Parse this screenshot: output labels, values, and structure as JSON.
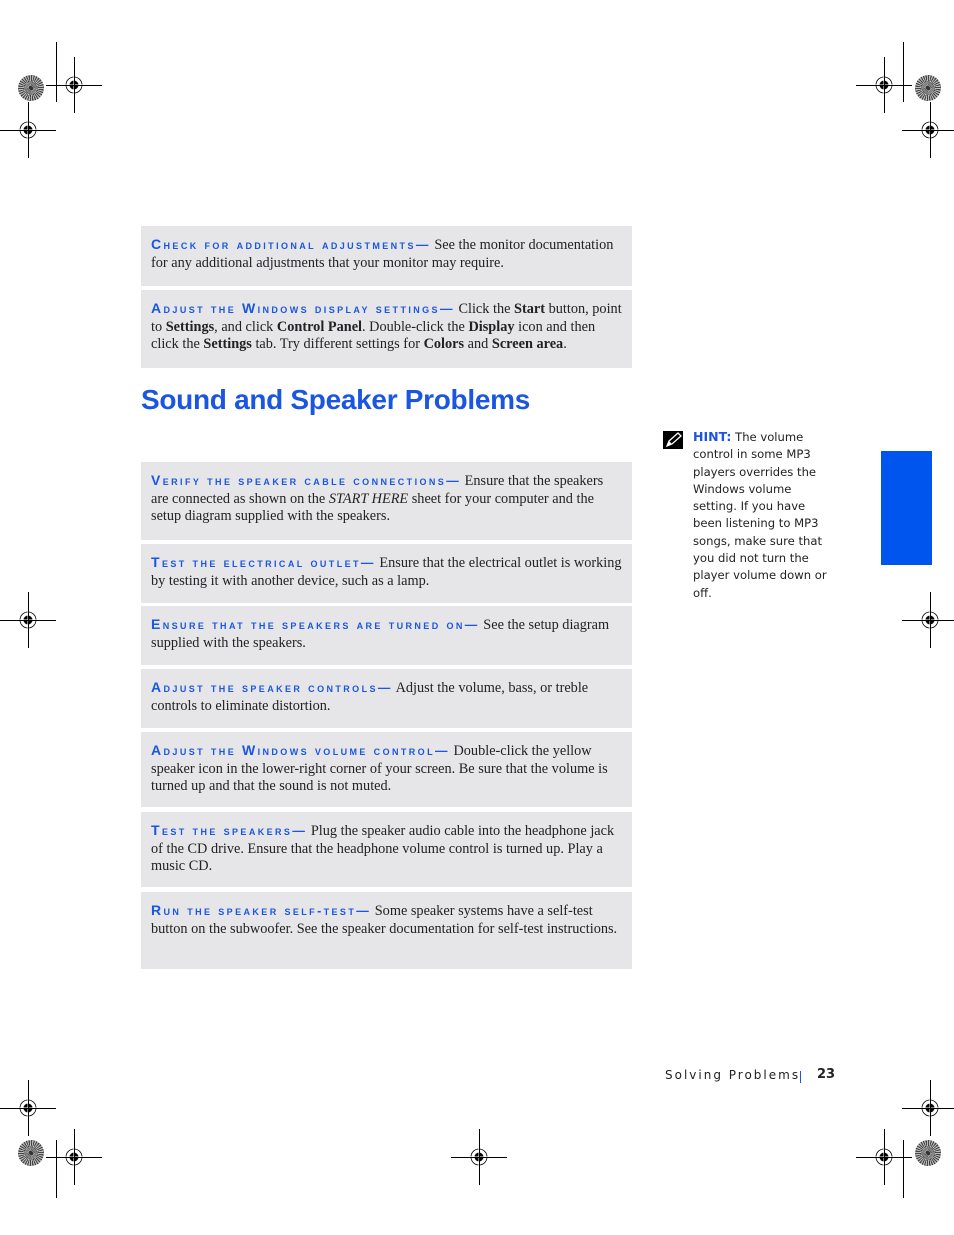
{
  "section_title": "Sound and Speaker Problems",
  "monitor_tips": [
    {
      "heading_cap": "C",
      "heading_rest": "heck for additional adjustments",
      "dash": "— ",
      "body_html_parts": [
        "See the monitor documentation for any additional adjustments that your monitor may require."
      ]
    },
    {
      "heading_cap": "A",
      "heading_rest": "djust the ",
      "heading_cap2": "W",
      "heading_rest2": "indows display settings",
      "dash": "— ",
      "segments": [
        {
          "t": "Click the "
        },
        {
          "b": "Start"
        },
        {
          "t": " button, point to "
        },
        {
          "b": "Settings"
        },
        {
          "t": ", and click "
        },
        {
          "b": "Control Panel"
        },
        {
          "t": ". Double-click the "
        },
        {
          "b": "Display"
        },
        {
          "t": " icon and then click the "
        },
        {
          "b": "Settings"
        },
        {
          "t": " tab. Try different settings for "
        },
        {
          "b": "Colors"
        },
        {
          "t": " and "
        },
        {
          "b": "Screen area"
        },
        {
          "t": "."
        }
      ]
    }
  ],
  "speaker_tips": [
    {
      "heading": "Verify the speaker cable connections",
      "segments": [
        {
          "t": "Ensure that the speakers are connected as shown on the "
        },
        {
          "i": "START HERE"
        },
        {
          "t": " sheet for your computer and the setup diagram supplied with the speakers."
        }
      ]
    },
    {
      "heading": "Test the electrical outlet",
      "segments": [
        {
          "t": "Ensure that the electrical outlet is working by testing it with another device, such as a lamp."
        }
      ]
    },
    {
      "heading": "Ensure that the speakers are turned on",
      "segments": [
        {
          "t": "See the setup diagram supplied with the speakers."
        }
      ]
    },
    {
      "heading": "Adjust the speaker controls",
      "segments": [
        {
          "t": "Adjust the volume, bass, or treble controls to eliminate distortion."
        }
      ]
    },
    {
      "heading": "Adjust the Windows volume control",
      "segments": [
        {
          "t": "Double-click the yellow speaker icon in the lower-right corner of your screen. Be sure that the volume is turned up and that the sound is not muted."
        }
      ]
    },
    {
      "heading": "Test the speakers",
      "segments": [
        {
          "t": "Plug the speaker audio cable into the headphone jack of the CD drive. Ensure that the headphone volume control is turned up. Play a music CD."
        }
      ]
    },
    {
      "heading": "Run the speaker self-test",
      "segments": [
        {
          "t": "Some speaker systems have a self-test button on the subwoofer. See the speaker documentation for self-test instructions."
        }
      ]
    }
  ],
  "hint": {
    "label": "HINT:",
    "text": "The volume control in some MP3 players overrides the Windows volume setting. If you have been listening to MP3 songs, make sure that you did not turn the player volume down or off.",
    "icon": "pencil-icon"
  },
  "footer": {
    "chapter": "Solving Problems",
    "page_number": "23"
  },
  "colors": {
    "accent": "#1a56e0",
    "box_bg": "#e6e6e8",
    "tab": "#0055ee"
  }
}
